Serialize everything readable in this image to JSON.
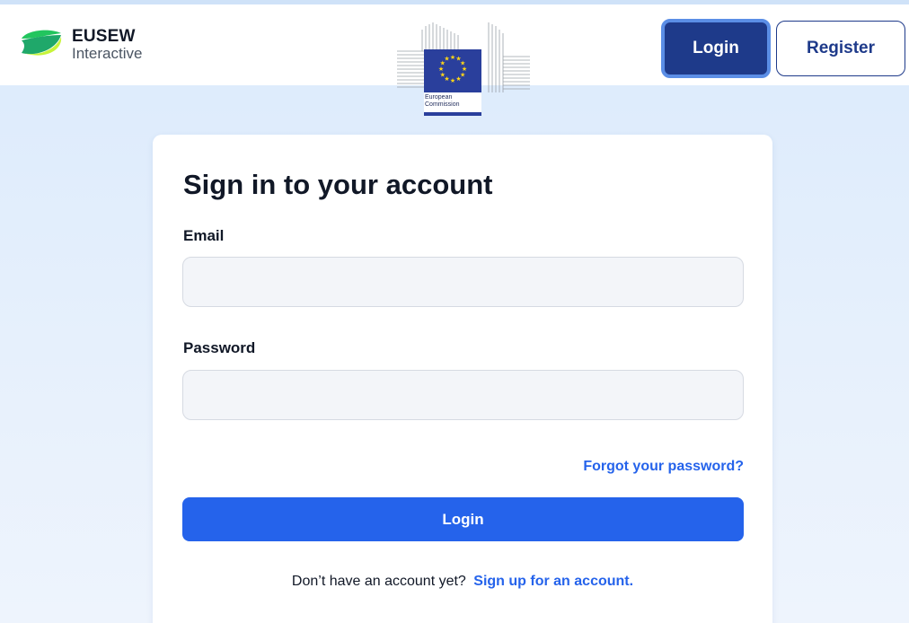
{
  "header": {
    "brand_title": "EUSEW",
    "brand_subtitle": "Interactive",
    "ec_logo_caption": "European Commission",
    "login_label": "Login",
    "register_label": "Register"
  },
  "form": {
    "title": "Sign in to your account",
    "email_label": "Email",
    "email_value": "",
    "password_label": "Password",
    "password_value": "",
    "forgot_label": "Forgot your password?",
    "submit_label": "Login",
    "signup_prompt": "Don’t have an account yet?",
    "signup_link": "Sign up for an account."
  },
  "colors": {
    "primary": "#2563eb",
    "navy": "#1e3a8a",
    "background": "#dbeafc",
    "brand_green": "#22c55e",
    "brand_lime": "#c7f43a",
    "eu_blue": "#2a3f9c",
    "eu_star": "#ffd617"
  }
}
